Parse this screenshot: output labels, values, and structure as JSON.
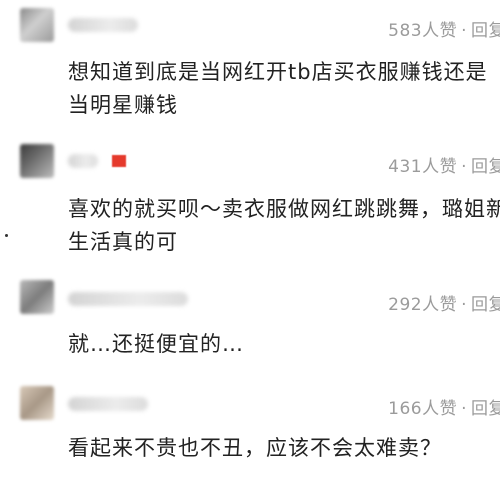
{
  "comments": [
    {
      "likes": "583人赞",
      "sep": "·",
      "reply": "回复",
      "text": "想知道到底是当网红开tb店买衣服赚钱还是当明星赚钱"
    },
    {
      "likes": "431人赞",
      "sep": "·",
      "reply": "回复",
      "text": "喜欢的就买呗～卖衣服做网红跳跳舞，璐姐新生活真的可"
    },
    {
      "likes": "292人赞",
      "sep": "·",
      "reply": "回复",
      "text": "就…还挺便宜的…"
    },
    {
      "likes": "166人赞",
      "sep": "·",
      "reply": "回复",
      "text": "看起来不贵也不丑，应该不会太难卖？"
    }
  ]
}
